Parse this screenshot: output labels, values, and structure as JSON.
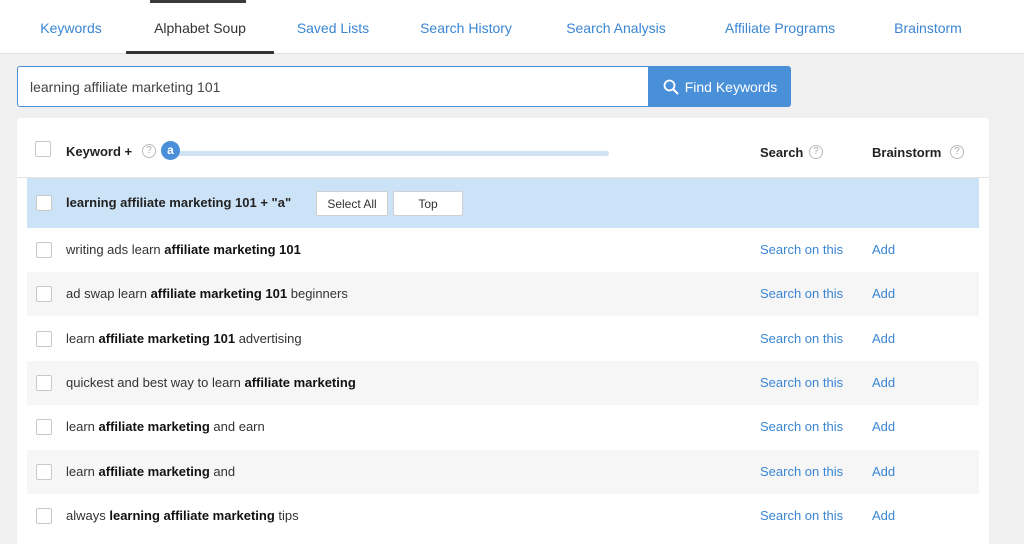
{
  "tabs": [
    {
      "label": "Keywords",
      "active": false
    },
    {
      "label": "Alphabet Soup",
      "active": true
    },
    {
      "label": "Saved Lists",
      "active": false
    },
    {
      "label": "Search History",
      "active": false
    },
    {
      "label": "Search Analysis",
      "active": false
    },
    {
      "label": "Affiliate Programs",
      "active": false
    },
    {
      "label": "Brainstorm",
      "active": false
    }
  ],
  "search": {
    "value": "learning affiliate marketing 101",
    "button_label": "Find Keywords",
    "button_icon": "search-icon"
  },
  "table": {
    "header": {
      "keyword_label": "Keyword +",
      "slider_letter": "a",
      "search_label": "Search",
      "brainstorm_label": "Brainstorm"
    },
    "group": {
      "label": "learning affiliate marketing 101 + \"a\"",
      "select_all_label": "Select All",
      "top_label": "Top"
    },
    "rows": [
      {
        "parts": [
          {
            "t": "writing ads learn ",
            "b": false
          },
          {
            "t": "affiliate marketing 101",
            "b": true
          }
        ],
        "search_link": "Search on this",
        "add_link": "Add"
      },
      {
        "parts": [
          {
            "t": "ad swap learn ",
            "b": false
          },
          {
            "t": "affiliate marketing 101",
            "b": true
          },
          {
            "t": " beginners",
            "b": false
          }
        ],
        "search_link": "Search on this",
        "add_link": "Add"
      },
      {
        "parts": [
          {
            "t": "learn ",
            "b": false
          },
          {
            "t": "affiliate marketing 101",
            "b": true
          },
          {
            "t": " advertising",
            "b": false
          }
        ],
        "search_link": "Search on this",
        "add_link": "Add"
      },
      {
        "parts": [
          {
            "t": "quickest and best way to learn ",
            "b": false
          },
          {
            "t": "affiliate marketing",
            "b": true
          }
        ],
        "search_link": "Search on this",
        "add_link": "Add"
      },
      {
        "parts": [
          {
            "t": "learn ",
            "b": false
          },
          {
            "t": "affiliate marketing",
            "b": true
          },
          {
            "t": " and earn",
            "b": false
          }
        ],
        "search_link": "Search on this",
        "add_link": "Add"
      },
      {
        "parts": [
          {
            "t": "learn ",
            "b": false
          },
          {
            "t": "affiliate marketing",
            "b": true
          },
          {
            "t": " and",
            "b": false
          }
        ],
        "search_link": "Search on this",
        "add_link": "Add"
      },
      {
        "parts": [
          {
            "t": "always ",
            "b": false
          },
          {
            "t": "learning affiliate marketing",
            "b": true
          },
          {
            "t": " tips",
            "b": false
          }
        ],
        "search_link": "Search on this",
        "add_link": "Add"
      }
    ]
  },
  "colors": {
    "accent": "#4a90d9",
    "link": "#3a86d4",
    "group_highlight": "#cce3f7"
  }
}
